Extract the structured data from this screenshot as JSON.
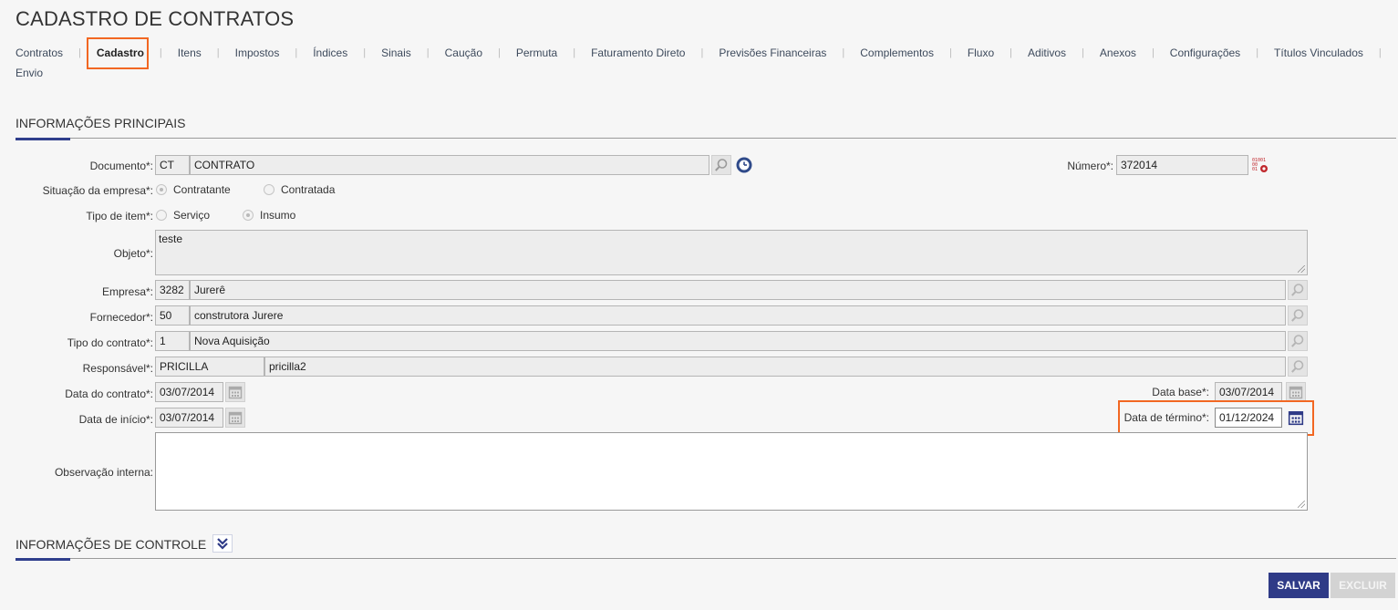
{
  "page": {
    "title": "CADASTRO DE CONTRATOS"
  },
  "tabs": {
    "row1": [
      "Contratos",
      "Cadastro",
      "Itens",
      "Impostos",
      "Índices",
      "Sinais",
      "Caução",
      "Permuta",
      "Faturamento Direto",
      "Previsões Financeiras",
      "Complementos",
      "Fluxo",
      "Aditivos",
      "Anexos",
      "Configurações",
      "Títulos Vinculados"
    ],
    "row2": [
      "Envio"
    ],
    "active": "Cadastro"
  },
  "sections": {
    "main": "INFORMAÇÕES PRINCIPAIS",
    "control": "INFORMAÇÕES DE CONTROLE"
  },
  "form": {
    "documento": {
      "label": "Documento*:",
      "code": "CT",
      "name": "CONTRATO"
    },
    "numero": {
      "label": "Número*:",
      "value": "372014"
    },
    "situacao": {
      "label": "Situação da empresa*:",
      "opt1": "Contratante",
      "opt2": "Contratada",
      "selected": "Contratante"
    },
    "tipo_item": {
      "label": "Tipo de item*:",
      "opt1": "Serviço",
      "opt2": "Insumo",
      "selected": "Insumo"
    },
    "objeto": {
      "label": "Objeto*:",
      "value": "teste"
    },
    "empresa": {
      "label": "Empresa*:",
      "code": "3282",
      "name": "Jurerê"
    },
    "fornecedor": {
      "label": "Fornecedor*:",
      "code": "50",
      "name": "construtora Jurere"
    },
    "tipo_contrato": {
      "label": "Tipo do contrato*:",
      "code": "1",
      "name": "Nova Aquisição"
    },
    "responsavel": {
      "label": "Responsável*:",
      "code": "PRICILLA",
      "name": "pricilla2"
    },
    "data_contrato": {
      "label": "Data do contrato*:",
      "value": "03/07/2014"
    },
    "data_base": {
      "label": "Data base*:",
      "value": "03/07/2014"
    },
    "data_inicio": {
      "label": "Data de início*:",
      "value": "03/07/2014"
    },
    "data_termino": {
      "label": "Data de término*:",
      "value": "01/12/2024"
    },
    "observacao": {
      "label": "Observação interna:",
      "value": ""
    }
  },
  "buttons": {
    "save": "SALVAR",
    "delete": "EXCLUIR"
  },
  "colors": {
    "accent": "#2f3b87",
    "highlight": "#f26722"
  }
}
